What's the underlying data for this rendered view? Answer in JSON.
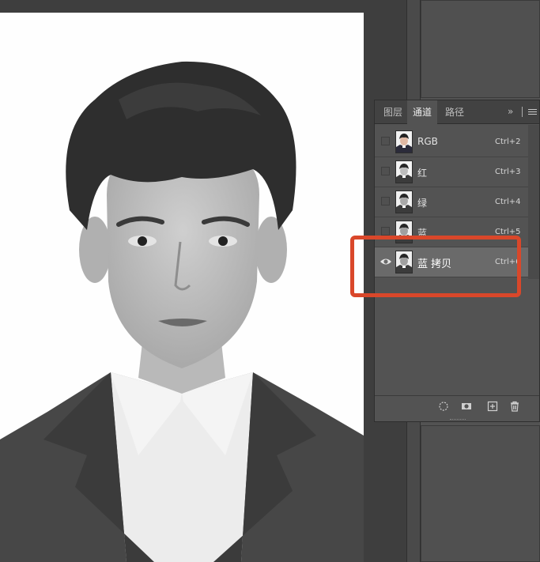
{
  "panel": {
    "tabs": [
      {
        "label": "图层",
        "active": false
      },
      {
        "label": "通道",
        "active": true
      },
      {
        "label": "路径",
        "active": false
      }
    ],
    "collapse_glyph": "»"
  },
  "channels": [
    {
      "name": "RGB",
      "shortcut": "Ctrl+2",
      "visible": false,
      "selected": false,
      "thumb": "color"
    },
    {
      "name": "红",
      "shortcut": "Ctrl+3",
      "visible": false,
      "selected": false,
      "thumb": "gray"
    },
    {
      "name": "绿",
      "shortcut": "Ctrl+4",
      "visible": false,
      "selected": false,
      "thumb": "gray"
    },
    {
      "name": "蓝",
      "shortcut": "Ctrl+5",
      "visible": false,
      "selected": false,
      "thumb": "gray"
    },
    {
      "name": "蓝 拷贝",
      "shortcut": "Ctrl+6",
      "visible": true,
      "selected": true,
      "thumb": "gray"
    }
  ],
  "footer_icons": [
    "load-selection-icon",
    "save-selection-icon",
    "new-channel-icon",
    "delete-channel-icon"
  ],
  "colors": {
    "highlight": "#d9472a",
    "panel_bg": "#535353",
    "selected_row": "#6a6a6a"
  }
}
